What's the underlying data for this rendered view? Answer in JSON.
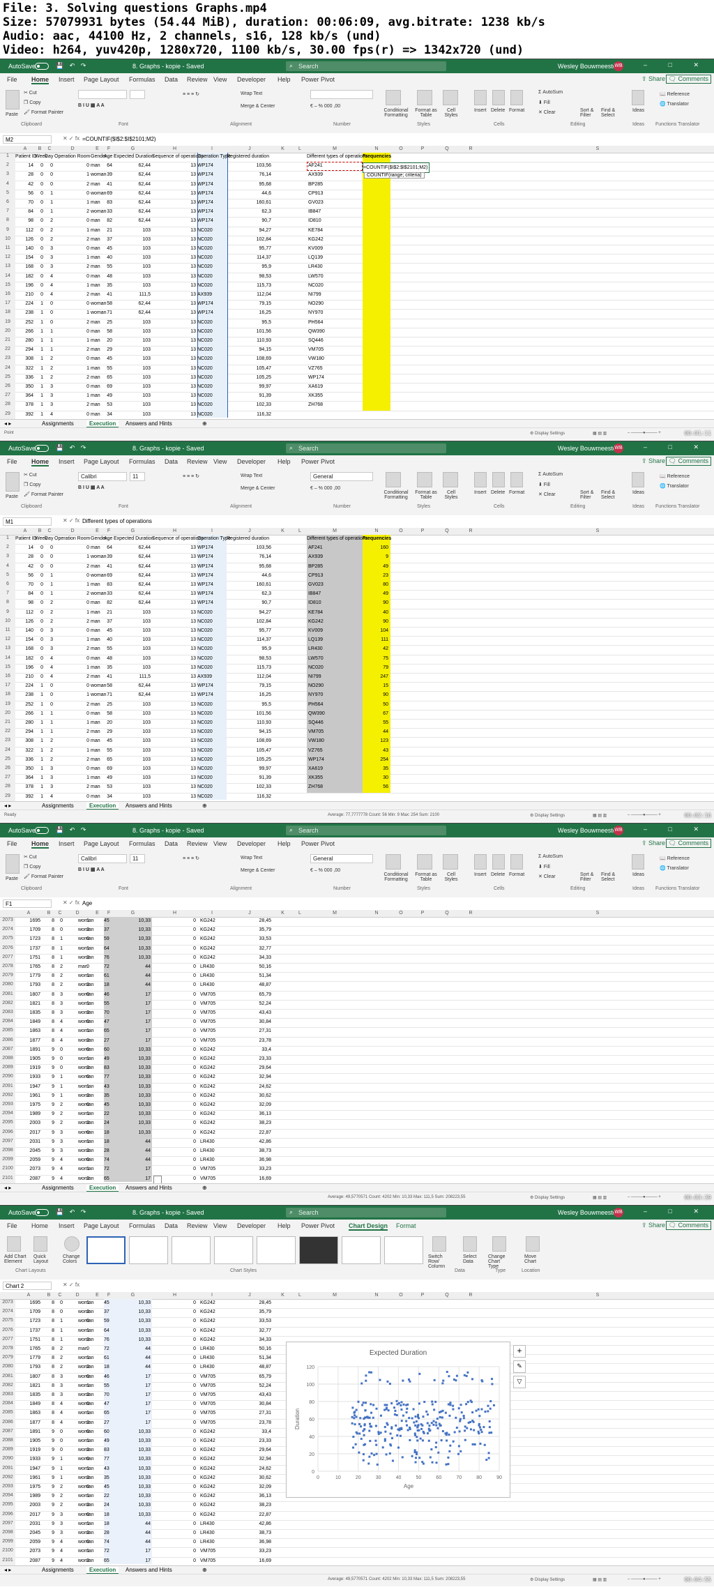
{
  "header": {
    "file": "File: 3. Solving questions Graphs.mp4",
    "size": "Size: 57079931 bytes (54.44 MiB), duration: 00:06:09, avg.bitrate: 1238 kb/s",
    "audio": "Audio: aac, 44100 Hz, 2 channels, s16, 128 kb/s (und)",
    "video": "Video: h264, yuv420p, 1280x720, 1100 kb/s, 30.00 fps(r) => 1342x720 (und)"
  },
  "app": {
    "autosave": "AutoSave",
    "autosave_state": "Off",
    "title": "8. Graphs - kopie - Saved",
    "search": "Search",
    "user": "Wesley Bouwmeester",
    "initials": "WB",
    "share": "Share",
    "comments": "Comments",
    "tabs": [
      "File",
      "Home",
      "Insert",
      "Page Layout",
      "Formulas",
      "Data",
      "Review",
      "View",
      "Developer",
      "Help",
      "Power Pivot"
    ],
    "chart_tabs": [
      "Chart Design",
      "Format"
    ]
  },
  "ribbon": {
    "clipboard": "Clipboard",
    "font": "Font",
    "alignment": "Alignment",
    "number": "Number",
    "styles": "Styles",
    "cells": "Cells",
    "editing": "Editing",
    "ideas_group": "Ideas",
    "functions_group": "Functions Translator",
    "paste": "Paste",
    "cut": "Cut",
    "copy": "Copy",
    "format_painter": "Format Painter",
    "font_name": "Calibri",
    "font_size": "11",
    "wrap_text": "Wrap Text",
    "merge_center": "Merge & Center",
    "number_format": "General",
    "conditional": "Conditional Formatting",
    "format_table": "Format as Table",
    "cell_styles": "Cell Styles",
    "insert": "Insert",
    "delete": "Delete",
    "format": "Format",
    "autosum": "AutoSum",
    "fill": "Fill",
    "clear": "Clear",
    "sort_filter": "Sort & Filter",
    "find_select": "Find & Select",
    "ideas": "Ideas",
    "reference": "Reference",
    "translator": "Translator",
    "add_chart": "Add Chart Element",
    "quick_layout": "Quick Layout",
    "change_colors": "Change Colors",
    "chart_layouts": "Chart Layouts",
    "chart_styles": "Chart Styles",
    "switch_row": "Switch Row/ Column",
    "select_data": "Select Data",
    "change_type": "Change Chart Type",
    "move_chart": "Move Chart",
    "data_group": "Data",
    "type_group": "Type",
    "location_group": "Location"
  },
  "sheets": [
    "Assignments",
    "Execution",
    "Answers and Hints"
  ],
  "columns_top": [
    "A",
    "B",
    "C",
    "D",
    "E",
    "F",
    "G",
    "H",
    "I",
    "J",
    "K",
    "L",
    "M",
    "N",
    "O",
    "P",
    "Q",
    "R",
    "S"
  ],
  "top_header": [
    "Patient ID",
    "Week",
    "Day",
    "Operation Room",
    "Gender",
    "Age",
    "Expected Duration",
    "Sequence of operations",
    "Operation Type",
    "Registered duration",
    "",
    "",
    "Different types of operations",
    "Frequencies"
  ],
  "top_rows": [
    [
      "14",
      "0",
      "0",
      "0",
      "man",
      "64",
      "62,44",
      "13",
      "WP174",
      "103,56"
    ],
    [
      "28",
      "0",
      "0",
      "1",
      "woman",
      "39",
      "62,44",
      "13",
      "WP174",
      "76,14"
    ],
    [
      "42",
      "0",
      "0",
      "2",
      "man",
      "41",
      "62,44",
      "13",
      "WP174",
      "95,68"
    ],
    [
      "56",
      "0",
      "1",
      "0",
      "woman",
      "69",
      "62,44",
      "13",
      "WP174",
      "44,6"
    ],
    [
      "70",
      "0",
      "1",
      "1",
      "man",
      "83",
      "62,44",
      "13",
      "WP174",
      "160,61"
    ],
    [
      "84",
      "0",
      "1",
      "2",
      "woman",
      "33",
      "62,44",
      "13",
      "WP174",
      "62,3"
    ],
    [
      "98",
      "0",
      "2",
      "0",
      "man",
      "82",
      "62,44",
      "13",
      "WP174",
      "90,7"
    ],
    [
      "112",
      "0",
      "2",
      "1",
      "man",
      "21",
      "103",
      "13",
      "NC020",
      "94,27"
    ],
    [
      "126",
      "0",
      "2",
      "2",
      "man",
      "37",
      "103",
      "13",
      "NC020",
      "102,84"
    ],
    [
      "140",
      "0",
      "3",
      "0",
      "man",
      "45",
      "103",
      "13",
      "NC020",
      "95,77"
    ],
    [
      "154",
      "0",
      "3",
      "1",
      "man",
      "40",
      "103",
      "13",
      "NC020",
      "114,37"
    ],
    [
      "168",
      "0",
      "3",
      "2",
      "man",
      "55",
      "103",
      "13",
      "NC020",
      "95,9"
    ],
    [
      "182",
      "0",
      "4",
      "0",
      "man",
      "48",
      "103",
      "13",
      "NC020",
      "98,53"
    ],
    [
      "196",
      "0",
      "4",
      "1",
      "man",
      "35",
      "103",
      "13",
      "NC020",
      "115,73"
    ],
    [
      "210",
      "0",
      "4",
      "2",
      "man",
      "41",
      "111,5",
      "13",
      "AX939",
      "112,04"
    ],
    [
      "224",
      "1",
      "0",
      "0",
      "woman",
      "58",
      "62,44",
      "13",
      "WP174",
      "79,15"
    ],
    [
      "238",
      "1",
      "0",
      "1",
      "woman",
      "71",
      "62,44",
      "13",
      "WP174",
      "16,25"
    ],
    [
      "252",
      "1",
      "0",
      "2",
      "man",
      "25",
      "103",
      "13",
      "NC020",
      "95,5"
    ],
    [
      "266",
      "1",
      "1",
      "0",
      "man",
      "58",
      "103",
      "13",
      "NC020",
      "101,56"
    ],
    [
      "280",
      "1",
      "1",
      "1",
      "man",
      "20",
      "103",
      "13",
      "NC020",
      "110,93"
    ],
    [
      "294",
      "1",
      "1",
      "2",
      "man",
      "29",
      "103",
      "13",
      "NC020",
      "94,15"
    ],
    [
      "308",
      "1",
      "2",
      "0",
      "man",
      "45",
      "103",
      "13",
      "NC020",
      "108,69"
    ],
    [
      "322",
      "1",
      "2",
      "1",
      "man",
      "55",
      "103",
      "13",
      "NC020",
      "105,47"
    ],
    [
      "336",
      "1",
      "2",
      "2",
      "man",
      "65",
      "103",
      "13",
      "NC020",
      "105,25"
    ],
    [
      "350",
      "1",
      "3",
      "0",
      "man",
      "69",
      "103",
      "13",
      "NC020",
      "99,97"
    ],
    [
      "364",
      "1",
      "3",
      "1",
      "man",
      "49",
      "103",
      "13",
      "NC020",
      "91,39"
    ],
    [
      "378",
      "1",
      "3",
      "2",
      "man",
      "53",
      "103",
      "13",
      "NC020",
      "102,33"
    ],
    [
      "392",
      "1",
      "4",
      "0",
      "man",
      "34",
      "103",
      "13",
      "NC020",
      "116,32"
    ]
  ],
  "op_types": [
    "AF241",
    "AX939",
    "BP285",
    "CP913",
    "GV023",
    "IB847",
    "ID810",
    "KE784",
    "KG242",
    "KV009",
    "LQ139",
    "LR430",
    "LW570",
    "NC020",
    "NI799",
    "NO290",
    "NY970",
    "PH564",
    "QW390",
    "SQ446",
    "VM705",
    "VW180",
    "VZ765",
    "WP174",
    "XA619",
    "XK355",
    "ZH768"
  ],
  "frequencies": [
    "160",
    "9",
    "49",
    "23",
    "80",
    "49",
    "90",
    "40",
    "90",
    "104",
    "111",
    "42",
    "75",
    "79",
    "247",
    "15",
    "90",
    "50",
    "67",
    "55",
    "44",
    "123",
    "43",
    "254",
    "35",
    "30",
    "56"
  ],
  "frames": [
    {
      "namebox": "M2",
      "formula": "=COUNTIF($I$2:$I$2101;M2)",
      "editing_formula": "=COUNTIF($I$2:$I$2101;M2)",
      "tooltip": "COUNTIF(range; criteria)",
      "status_left": "Point",
      "timestamp": "00:01:11"
    },
    {
      "namebox": "M1",
      "formula": "Different types of operations",
      "status_left": "Ready",
      "status_mid": "Average: 77,7777778    Count: 56    Min: 9    Max: 254    Sum: 2100",
      "timestamp": "00:02:16"
    },
    {
      "namebox": "F1",
      "formula": "Age",
      "status_left": "",
      "status_mid": "Average: 49,5770571    Count: 4202    Min: 10,33    Max: 111,5    Sum: 208223,55",
      "timestamp": "00:03:39"
    },
    {
      "namebox": "Chart 2",
      "formula": "",
      "status_left": "",
      "status_mid": "Average: 49,5770571    Count: 4202    Min: 10,33    Max: 111,5    Sum: 208223,55",
      "timestamp": "00:04:55"
    }
  ],
  "bottom_rows": [
    [
      "2073",
      "1695",
      "8",
      "0",
      "1",
      "woman",
      "45",
      "10,33",
      "0",
      "KG242",
      "28,45"
    ],
    [
      "2074",
      "1709",
      "8",
      "0",
      "2",
      "woman",
      "37",
      "10,33",
      "0",
      "KG242",
      "35,79"
    ],
    [
      "2075",
      "1723",
      "8",
      "1",
      "0",
      "woman",
      "59",
      "10,33",
      "0",
      "KG242",
      "33,53"
    ],
    [
      "2076",
      "1737",
      "8",
      "1",
      "1",
      "woman",
      "64",
      "10,33",
      "0",
      "KG242",
      "32,77"
    ],
    [
      "2077",
      "1751",
      "8",
      "1",
      "2",
      "woman",
      "76",
      "10,33",
      "0",
      "KG242",
      "34,33"
    ],
    [
      "2078",
      "1765",
      "8",
      "2",
      "0",
      "man",
      "72",
      "44",
      "0",
      "LR430",
      "50,16"
    ],
    [
      "2079",
      "1779",
      "8",
      "2",
      "1",
      "woman",
      "61",
      "44",
      "0",
      "LR430",
      "51,34"
    ],
    [
      "2080",
      "1793",
      "8",
      "2",
      "2",
      "woman",
      "18",
      "44",
      "0",
      "LR430",
      "48,87"
    ],
    [
      "2081",
      "1807",
      "8",
      "3",
      "0",
      "woman",
      "46",
      "17",
      "0",
      "VM705",
      "65,79"
    ],
    [
      "2082",
      "1821",
      "8",
      "3",
      "1",
      "woman",
      "55",
      "17",
      "0",
      "VM705",
      "52,24"
    ],
    [
      "2083",
      "1835",
      "8",
      "3",
      "2",
      "woman",
      "70",
      "17",
      "0",
      "VM705",
      "43,43"
    ],
    [
      "2084",
      "1849",
      "8",
      "4",
      "0",
      "woman",
      "47",
      "17",
      "0",
      "VM705",
      "30,84"
    ],
    [
      "2085",
      "1863",
      "8",
      "4",
      "1",
      "woman",
      "65",
      "17",
      "0",
      "VM705",
      "27,31"
    ],
    [
      "2086",
      "1877",
      "8",
      "4",
      "2",
      "woman",
      "27",
      "17",
      "0",
      "VM705",
      "23,78"
    ],
    [
      "2087",
      "1891",
      "9",
      "0",
      "0",
      "woman",
      "60",
      "10,33",
      "0",
      "KG242",
      "33,4"
    ],
    [
      "2088",
      "1905",
      "9",
      "0",
      "1",
      "woman",
      "49",
      "10,33",
      "0",
      "KG242",
      "23,33"
    ],
    [
      "2089",
      "1919",
      "9",
      "0",
      "2",
      "woman",
      "83",
      "10,33",
      "0",
      "KG242",
      "29,64"
    ],
    [
      "2090",
      "1933",
      "9",
      "1",
      "0",
      "woman",
      "77",
      "10,33",
      "0",
      "KG242",
      "32,94"
    ],
    [
      "2091",
      "1947",
      "9",
      "1",
      "1",
      "woman",
      "43",
      "10,33",
      "0",
      "KG242",
      "24,62"
    ],
    [
      "2092",
      "1961",
      "9",
      "1",
      "2",
      "woman",
      "35",
      "10,33",
      "0",
      "KG242",
      "30,62"
    ],
    [
      "2093",
      "1975",
      "9",
      "2",
      "0",
      "woman",
      "45",
      "10,33",
      "0",
      "KG242",
      "32,09"
    ],
    [
      "2094",
      "1989",
      "9",
      "2",
      "1",
      "woman",
      "22",
      "10,33",
      "0",
      "KG242",
      "36,13"
    ],
    [
      "2095",
      "2003",
      "9",
      "2",
      "2",
      "woman",
      "24",
      "10,33",
      "0",
      "KG242",
      "38,23"
    ],
    [
      "2096",
      "2017",
      "9",
      "3",
      "0",
      "woman",
      "18",
      "10,33",
      "0",
      "KG242",
      "22,87"
    ],
    [
      "2097",
      "2031",
      "9",
      "3",
      "1",
      "woman",
      "18",
      "44",
      "0",
      "LR430",
      "42,86"
    ],
    [
      "2098",
      "2045",
      "9",
      "3",
      "2",
      "woman",
      "28",
      "44",
      "0",
      "LR430",
      "38,73"
    ],
    [
      "2099",
      "2059",
      "9",
      "4",
      "0",
      "woman",
      "74",
      "44",
      "0",
      "LR430",
      "36,98"
    ],
    [
      "2100",
      "2073",
      "9",
      "4",
      "1",
      "woman",
      "72",
      "17",
      "0",
      "VM705",
      "33,23"
    ],
    [
      "2101",
      "2087",
      "9",
      "4",
      "2",
      "woman",
      "65",
      "17",
      "0",
      "VM705",
      "16,69"
    ]
  ],
  "chart_data": {
    "type": "scatter",
    "title": "Expected Duration",
    "xlabel": "Age",
    "ylabel": "Duration",
    "xlim": [
      0,
      90
    ],
    "ylim": [
      0,
      120
    ],
    "xticks": [
      "0",
      "10",
      "20",
      "30",
      "40",
      "50",
      "60",
      "70",
      "80",
      "90"
    ],
    "yticks": [
      "0",
      "20",
      "40",
      "60",
      "80",
      "100",
      "120"
    ],
    "grid": true,
    "series": [
      {
        "values_x": [
          17,
          88
        ],
        "values_y": [
          10.33,
          111.5
        ]
      }
    ]
  }
}
